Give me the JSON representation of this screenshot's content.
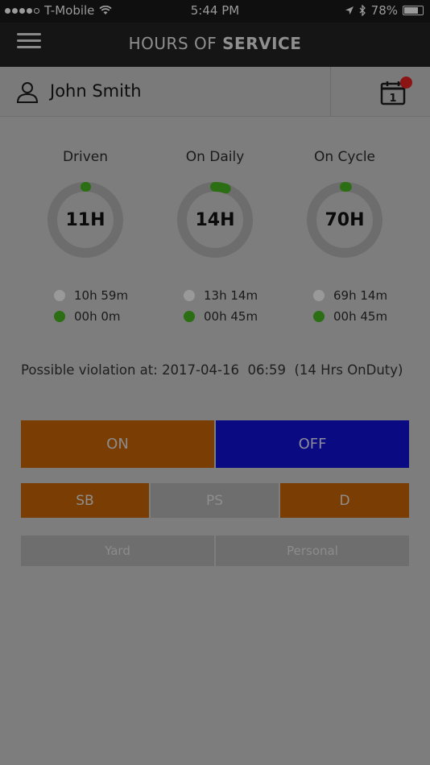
{
  "status_bar": {
    "carrier": "T-Mobile",
    "time": "5:44 PM",
    "battery": "78%",
    "battery_level": 0.78,
    "signal_bars_filled": 4
  },
  "header": {
    "title_light": "HOURS OF ",
    "title_bold": "SERVICE",
    "menu_icon": "hamburger-menu-icon"
  },
  "user": {
    "name": "John Smith",
    "icon": "user-icon",
    "calendar_icon": "calendar-icon",
    "calendar_day": "1",
    "notification_color": "#8b1414"
  },
  "gauges": [
    {
      "label": "Driven",
      "center": "11H",
      "remaining": "10h 59m",
      "used": "00h 0m",
      "used_fraction": 0.004
    },
    {
      "label": "On Daily",
      "center": "14H",
      "remaining": "13h 14m",
      "used": "00h 45m",
      "used_fraction": 0.054
    },
    {
      "label": "On Cycle",
      "center": "70H",
      "remaining": "69h 14m",
      "used": "00h 45m",
      "used_fraction": 0.011
    }
  ],
  "violation": {
    "text": "Possible violation at: 2017-04-16  06:59  (14 Hrs OnDuty)"
  },
  "duty_buttons": {
    "on": "ON",
    "off": "OFF",
    "sb": "SB",
    "ps": "PS",
    "d": "D",
    "yard": "Yard",
    "personal": "Personal"
  },
  "colors": {
    "on_duty": "#7a3d03",
    "off_duty": "#0a0a82",
    "used_green": "#2b6e14",
    "ring_grey": "#6d6d6d"
  }
}
